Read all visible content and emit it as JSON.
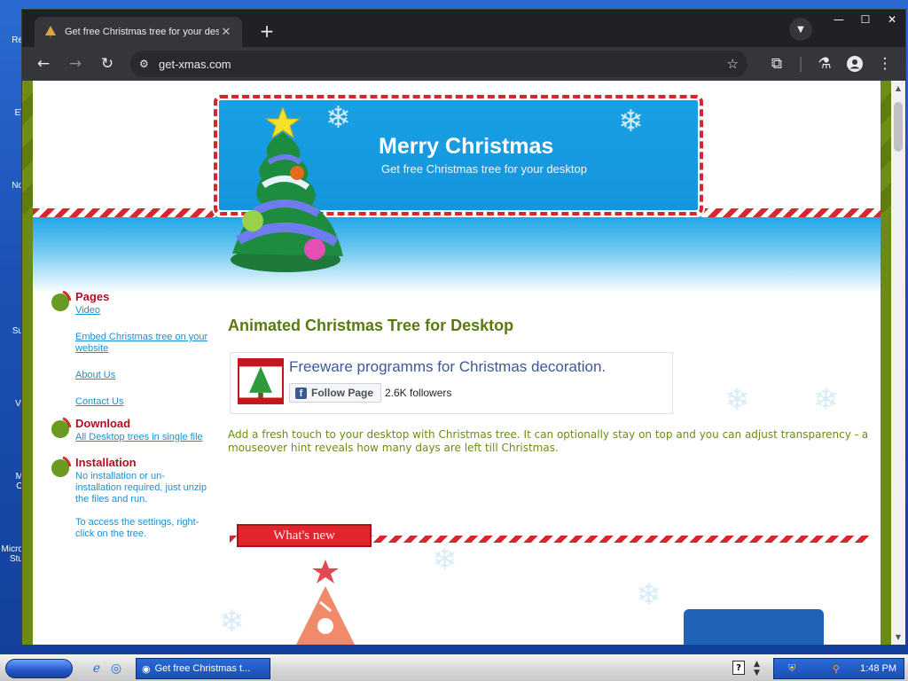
{
  "desktop": {
    "labels": [
      "Re",
      "E\\",
      "No",
      "Su",
      "Vl",
      "M\nO",
      "Micro\nStu"
    ]
  },
  "browser": {
    "tab": {
      "title": "Get free Christmas tree for your desktop"
    },
    "toolbar": {
      "url": "get-xmas.com"
    }
  },
  "page": {
    "header": {
      "title": "Merry Christmas",
      "subtitle": "Get free Christmas tree for your desktop"
    },
    "sidebar": {
      "pages_heading": "Pages",
      "links": [
        "Video",
        "Embed Christmas tree on your website",
        "About Us",
        "Contact Us"
      ],
      "download_heading": "Download",
      "download_link": "All Desktop trees in single file",
      "installation_heading": "Installation",
      "installation_text_1": "No installation or un-installation required, just unzip the files and run.",
      "installation_text_2": "To access the settings, right-click on the tree."
    },
    "main": {
      "title": "Animated Christmas Tree for Desktop",
      "fb": {
        "title": "Freeware programms for Christmas decoration.",
        "follow_label": "Follow Page",
        "followers": "2.6K followers"
      },
      "description": "Add a fresh touch to your desktop with Christmas tree. It can optionally stay on top and you can adjust transparency - a mouseover hint reveals how many days are left till Christmas.",
      "whats_new": "What's new"
    }
  },
  "taskbar": {
    "task_item": "Get free Christmas t...",
    "clock": "1:48 PM"
  },
  "colors": {
    "olive": "#6b8a18",
    "sky": "#18a0e4",
    "candy_red": "#d7262e",
    "link": "#1a8fd4",
    "heading_red": "#b01020",
    "title_green": "#5a7a10"
  }
}
